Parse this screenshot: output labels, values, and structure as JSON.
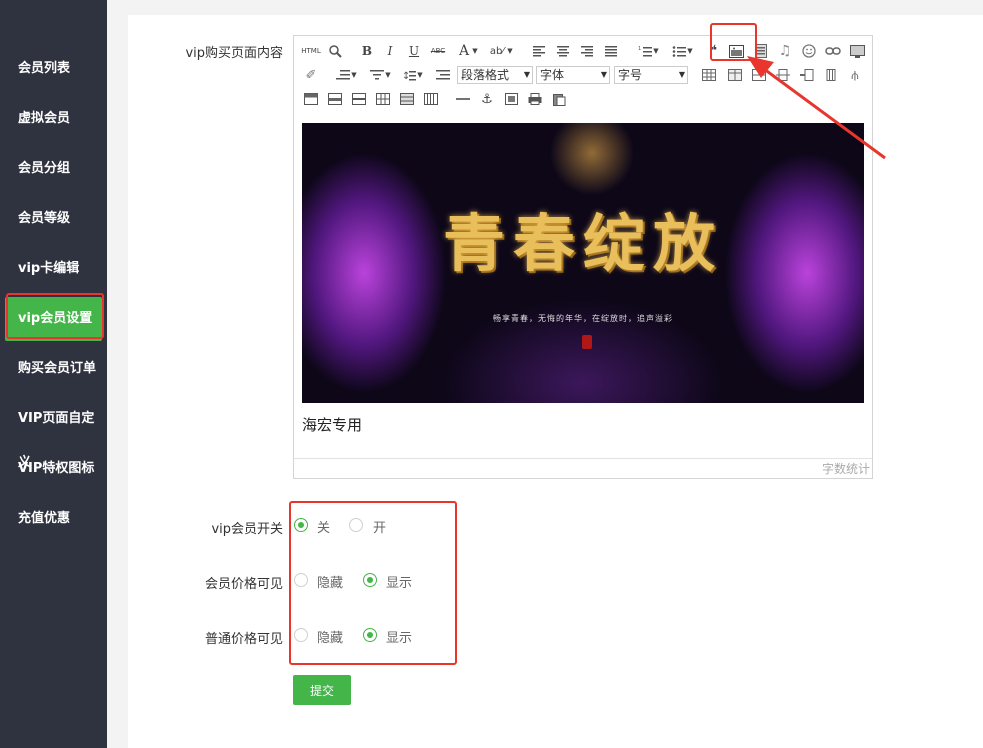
{
  "sidebar": {
    "items": [
      {
        "label": "会员列表"
      },
      {
        "label": "虚拟会员"
      },
      {
        "label": "会员分组"
      },
      {
        "label": "会员等级"
      },
      {
        "label": "vip卡编辑"
      },
      {
        "label": "vip会员设置",
        "active": true
      },
      {
        "label": "购买会员订单"
      },
      {
        "label": "VIP页面自定义"
      },
      {
        "label": "VIP特权图标"
      },
      {
        "label": "充值优惠"
      }
    ]
  },
  "form": {
    "content_label": "vip购买页面内容",
    "editor": {
      "toolbar": {
        "html_label": "HTML",
        "bold": "B",
        "italic": "I",
        "underline": "U",
        "strike": "ABC",
        "fontcolor": "A",
        "paragraph_select": "段落格式",
        "font_select": "字体",
        "size_select": "字号"
      },
      "banner": {
        "title": "青春绽放",
        "subtitle": "畅享青春，无悔的年华，在绽放时，追声溢彩"
      },
      "content_text": "海宏专用",
      "word_count": "字数统计"
    },
    "vip_switch": {
      "label": "vip会员开关",
      "options": [
        "关",
        "开"
      ],
      "selected": 0
    },
    "member_price": {
      "label": "会员价格可见",
      "options": [
        "隐藏",
        "显示"
      ],
      "selected": 1
    },
    "normal_price": {
      "label": "普通价格可见",
      "options": [
        "隐藏",
        "显示"
      ],
      "selected": 1
    },
    "submit_label": "提交"
  },
  "colors": {
    "sidebar_bg": "#2f3340",
    "accent": "#44b549",
    "highlight": "#e8362d"
  }
}
